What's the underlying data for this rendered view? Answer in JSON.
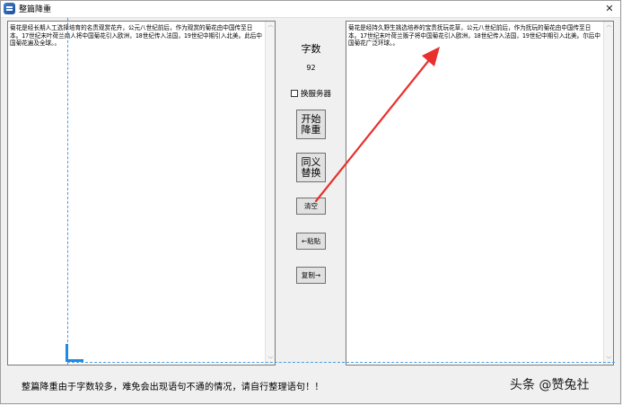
{
  "window": {
    "title": "整篇降重",
    "close_glyph": "✕"
  },
  "left_text": "菊花是经长期人工选择培育的名贵观赏花卉，公元八世纪前后，作为观赏的菊花由中国传至日本。17世纪末叶荷兰商人将中国菊花引入欧洲，18世纪传入法国，19世纪中期引入北美。此后中国菊花遍及全球。。",
  "right_text": "菊花是经持久野生挑选培养的宝贵抚玩花草，公元八世纪前后，作为抚玩的菊花由中国传至日本。17世纪末叶荷兰贩子将中国菊花引入欧洲，18世纪传入法国，19世纪中期引入北美。尔后中国菊花广泛环球。。",
  "word_count": {
    "label": "字数",
    "value": "92"
  },
  "server_option": {
    "label": "换服务器",
    "checked": false
  },
  "buttons": {
    "dereduce": "开始\n降重",
    "synonym": "同义\n替换",
    "clear": "清空",
    "paste": "←粘贴",
    "copy": "复制→"
  },
  "scroll": {
    "up": "︿",
    "down": "﹀"
  },
  "footer_note": "整篇降重由于字数较多，难免会出现语句不通的情况，请自行整理语句！！",
  "watermark": "头条 @赞兔社",
  "colors": {
    "annotation_arrow": "#e8302c",
    "guide_line": "#4a9be0"
  }
}
